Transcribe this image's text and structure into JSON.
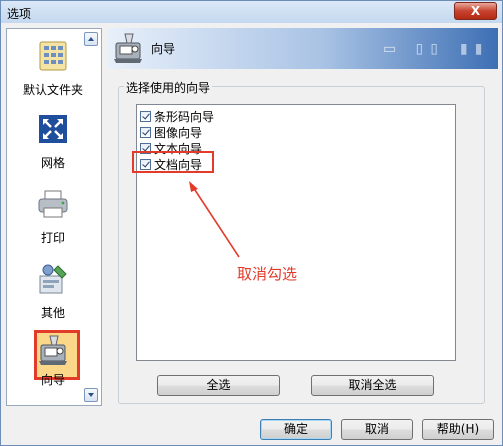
{
  "window": {
    "title": "选项",
    "close_label": "X"
  },
  "nav": {
    "items": [
      {
        "label": "默认文件夹",
        "icon": "folder-grid-icon"
      },
      {
        "label": "网格",
        "icon": "grid-arrows-icon"
      },
      {
        "label": "打印",
        "icon": "printer-icon"
      },
      {
        "label": "其他",
        "icon": "misc-tools-icon"
      },
      {
        "label": "向导",
        "icon": "wizard-icon"
      }
    ],
    "selected": "向导"
  },
  "header": {
    "title": "向导",
    "icon": "wizard-icon"
  },
  "group": {
    "legend": "选择使用的向导"
  },
  "wizards": [
    {
      "label": "条形码向导",
      "checked": true
    },
    {
      "label": "图像向导",
      "checked": true
    },
    {
      "label": "文本向导",
      "checked": true
    },
    {
      "label": "文档向导",
      "checked": true
    }
  ],
  "buttons": {
    "select_all": "全选",
    "deselect_all": "取消全选",
    "ok": "确定",
    "cancel": "取消",
    "help": "帮助(H)"
  },
  "annotation": {
    "text": "取消勾选",
    "color": "#e23b2a"
  }
}
